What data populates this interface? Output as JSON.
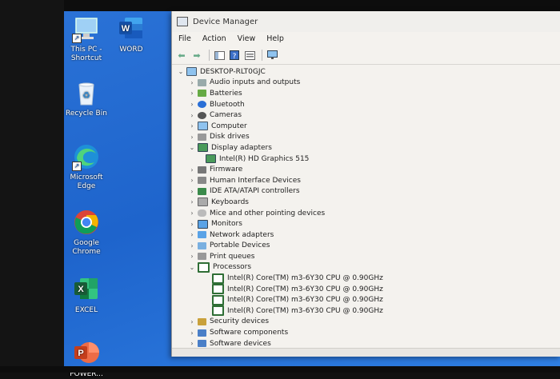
{
  "desktop": {
    "icons": [
      {
        "label": "This PC -\nShortcut",
        "icon": "computer-icon"
      },
      {
        "label": "WORD",
        "icon": "word-icon"
      },
      {
        "label": "Recycle Bin",
        "icon": "recycle-bin-icon"
      },
      {
        "label": "Microsoft\nEdge",
        "icon": "edge-icon"
      },
      {
        "label": "Google\nChrome",
        "icon": "chrome-icon"
      },
      {
        "label": "EXCEL",
        "icon": "excel-icon"
      },
      {
        "label": "POWER...",
        "icon": "powerpoint-icon"
      }
    ]
  },
  "window": {
    "title": "Device Manager",
    "menu": [
      "File",
      "Action",
      "View",
      "Help"
    ],
    "tree": {
      "root": "DESKTOP-RLT0GJC",
      "items": [
        {
          "label": "Audio inputs and outputs",
          "expanded": false
        },
        {
          "label": "Batteries",
          "expanded": false
        },
        {
          "label": "Bluetooth",
          "expanded": false
        },
        {
          "label": "Cameras",
          "expanded": false
        },
        {
          "label": "Computer",
          "expanded": false
        },
        {
          "label": "Disk drives",
          "expanded": false
        },
        {
          "label": "Display adapters",
          "expanded": true,
          "children": [
            "Intel(R) HD Graphics 515"
          ]
        },
        {
          "label": "Firmware",
          "expanded": false
        },
        {
          "label": "Human Interface Devices",
          "expanded": false
        },
        {
          "label": "IDE ATA/ATAPI controllers",
          "expanded": false
        },
        {
          "label": "Keyboards",
          "expanded": false
        },
        {
          "label": "Mice and other pointing devices",
          "expanded": false
        },
        {
          "label": "Monitors",
          "expanded": false
        },
        {
          "label": "Network adapters",
          "expanded": false
        },
        {
          "label": "Portable Devices",
          "expanded": false
        },
        {
          "label": "Print queues",
          "expanded": false
        },
        {
          "label": "Processors",
          "expanded": true,
          "children": [
            "Intel(R) Core(TM) m3-6Y30 CPU @ 0.90GHz",
            "Intel(R) Core(TM) m3-6Y30 CPU @ 0.90GHz",
            "Intel(R) Core(TM) m3-6Y30 CPU @ 0.90GHz",
            "Intel(R) Core(TM) m3-6Y30 CPU @ 0.90GHz"
          ]
        },
        {
          "label": "Security devices",
          "expanded": false
        },
        {
          "label": "Software components",
          "expanded": false
        },
        {
          "label": "Software devices",
          "expanded": false
        }
      ]
    }
  },
  "colors": {
    "desktop": "#1e64cc",
    "window_bg": "#f4f2ee"
  }
}
